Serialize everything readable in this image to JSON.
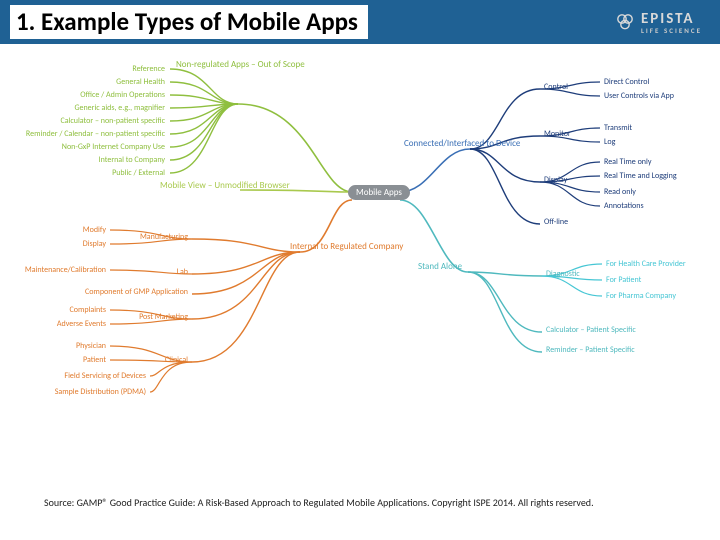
{
  "header": {
    "title": "1. Example Types of Mobile Apps",
    "brand_name": "EPISTA",
    "brand_sub": "LIFE SCIENCE"
  },
  "diagram": {
    "center": "Mobile Apps",
    "colors": {
      "green": "#8fbf3f",
      "orange": "#e07b2e",
      "blue": "#3a6fb5",
      "navy": "#1e3d7a",
      "teal": "#4fb9be",
      "cyan": "#46c6d4",
      "grey": "#6f7a84"
    },
    "branches_left_top": {
      "label": "Non-regulated Apps – Out of Scope",
      "color": "green",
      "children": [
        "Reference",
        "General Health",
        "Office / Admin Operations",
        "Generic aids, e.g., magnifier",
        "Calculator – non-patient specific",
        "Reminder / Calendar – non-patient specific",
        "Non-GxP Internet Company Use",
        "Internal to Company",
        "Public / External"
      ],
      "extra": "Mobile View – Unmodified Browser"
    },
    "branches_left_bottom": {
      "label": "Internal to Regulated Company",
      "color": "orange",
      "groups": [
        {
          "name": "Manufacturing",
          "children": [
            "Modify",
            "Display"
          ]
        },
        {
          "name": "Lab",
          "children": [
            "Maintenance/Calibration"
          ]
        },
        {
          "name": "Component of GMP Application",
          "children": []
        },
        {
          "name": "Post Marketing",
          "children": [
            "Complaints",
            "Adverse Events"
          ]
        },
        {
          "name": "Clinical",
          "children": [
            "Physician",
            "Patient",
            "Field Servicing of Devices",
            "Sample Distribution (PDMA)"
          ]
        }
      ]
    },
    "branches_right_top": {
      "label": "Connected/Interfaced to Device",
      "color": "blue",
      "groups": [
        {
          "name": "Control",
          "children": [
            "Direct Control",
            "User Controls via App"
          ]
        },
        {
          "name": "Monitor",
          "children": [
            "Transmit",
            "Log"
          ]
        },
        {
          "name": "Display",
          "children": [
            "Real Time only",
            "Real Time and Logging",
            "Read only",
            "Annotations"
          ]
        },
        {
          "name": "Off-line",
          "children": []
        }
      ]
    },
    "branches_right_bottom": {
      "label": "Stand Alone",
      "color": "teal",
      "groups": [
        {
          "name": "Diagnostic",
          "children": [
            "For Health Care Provider",
            "For Patient",
            "For Pharma Company"
          ]
        },
        {
          "name": "Calculator – Patient Specific",
          "children": []
        },
        {
          "name": "Reminder – Patient Specific",
          "children": []
        }
      ]
    }
  },
  "source": "Source: GAMP® Good Practice Guide: A Risk-Based Approach to Regulated Mobile Applications. Copyright ISPE 2014. All rights reserved."
}
